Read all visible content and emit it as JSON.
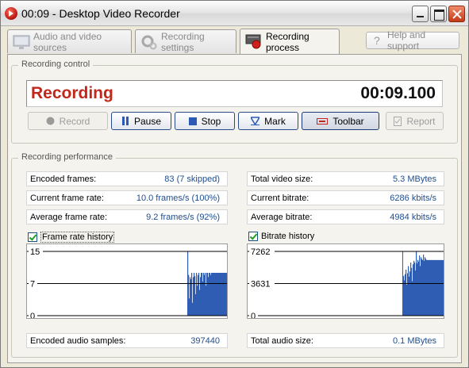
{
  "window": {
    "title": "00:09 - Desktop Video Recorder"
  },
  "tabs": [
    {
      "label": "Audio and video sources",
      "active": false
    },
    {
      "label": "Recording settings",
      "active": false
    },
    {
      "label": "Recording process",
      "active": true
    }
  ],
  "help_button": {
    "label": "Help and support"
  },
  "recording_control": {
    "title": "Recording control",
    "status": "Recording",
    "time": "00:09.100",
    "status_color": "#c0281c",
    "buttons": {
      "record": "Record",
      "pause": "Pause",
      "stop": "Stop",
      "mark": "Mark",
      "toolbar": "Toolbar",
      "report": "Report"
    }
  },
  "performance": {
    "title": "Recording performance",
    "left": [
      {
        "label": "Encoded frames:",
        "value": "83 (7 skipped)"
      },
      {
        "label": "Current frame rate:",
        "value": "10.0 frames/s (100%)"
      },
      {
        "label": "Average frame rate:",
        "value": "9.2 frames/s (92%)"
      }
    ],
    "right": [
      {
        "label": "Total video size:",
        "value": "5.3 MBytes"
      },
      {
        "label": "Current bitrate:",
        "value": "6286 kbits/s"
      },
      {
        "label": "Average bitrate:",
        "value": "4984 kbits/s"
      }
    ],
    "frame_rate_history": {
      "label": "Frame rate history",
      "checked": true,
      "ticks": [
        "15",
        "7",
        "0"
      ],
      "max": 15,
      "values": [
        15,
        9.5,
        4,
        9,
        8.5,
        10,
        3,
        9,
        10,
        9.2,
        5,
        10,
        7,
        9.5,
        10,
        6,
        9,
        10,
        10,
        8,
        10,
        9.5,
        10,
        7,
        10,
        10,
        9,
        10,
        10,
        9.5,
        10,
        10,
        10,
        10,
        10,
        10,
        10,
        10,
        10,
        10,
        10,
        10,
        10,
        10,
        10,
        10,
        10,
        10,
        10,
        10
      ]
    },
    "bitrate_history": {
      "label": "Bitrate history",
      "checked": true,
      "ticks": [
        "7262",
        "3631",
        "0"
      ],
      "max": 7262,
      "values": [
        1500,
        4500,
        4000,
        4700,
        5200,
        3500,
        4800,
        5600,
        4400,
        5000,
        6000,
        5400,
        3900,
        5800,
        6200,
        6000,
        5100,
        7262,
        5900,
        6300,
        6100,
        6800,
        5600,
        6600,
        6400,
        6286,
        6900,
        6200,
        6600,
        6400,
        6286,
        6286,
        6286,
        6286,
        6286,
        6286,
        6286,
        6286,
        6286,
        6286,
        6286,
        6286,
        6286,
        6286,
        6286,
        6286,
        6286,
        6286,
        6286,
        6286,
        6286,
        6286
      ]
    },
    "audio_samples": {
      "label": "Encoded audio samples:",
      "value": "397440"
    },
    "audio_size": {
      "label": "Total audio size:",
      "value": "0.1 MBytes"
    },
    "value_color": "#1f4d8f",
    "graph_color": "#2f5db3"
  }
}
